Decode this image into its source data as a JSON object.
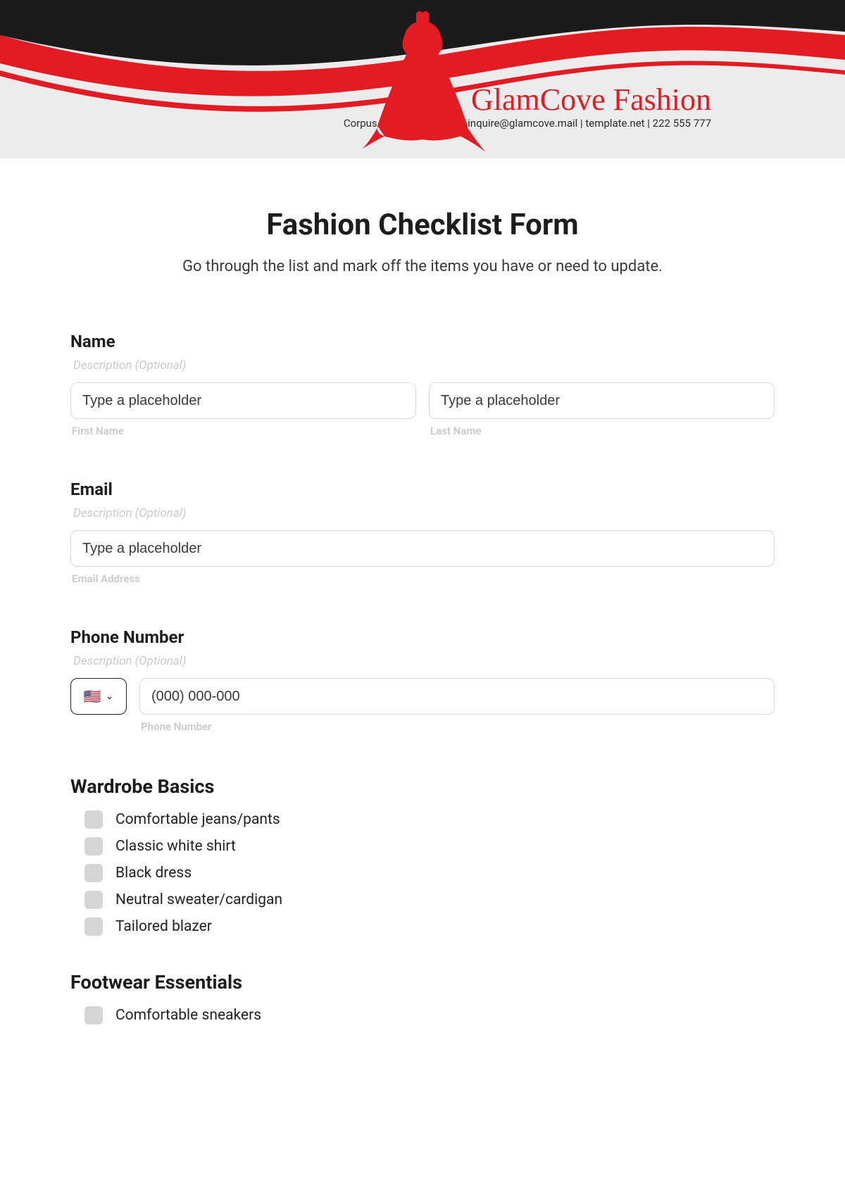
{
  "header": {
    "brand_name": "GlamCove Fashion",
    "contact_line": "Corpus Christi, TX 78401 | inquire@glamcove.mail | template.net | 222 555 777"
  },
  "form": {
    "title": "Fashion Checklist Form",
    "subtitle": "Go through the list and mark off the items you have or need to update.",
    "name": {
      "label": "Name",
      "description": "Description (Optional)",
      "first_placeholder": "Type a placeholder",
      "first_sublabel": "First Name",
      "last_placeholder": "Type a placeholder",
      "last_sublabel": "Last Name"
    },
    "email": {
      "label": "Email",
      "description": "Description (Optional)",
      "placeholder": "Type a placeholder",
      "sublabel": "Email Address"
    },
    "phone": {
      "label": "Phone Number",
      "description": "Description (Optional)",
      "flag": "🇺🇸",
      "placeholder": "(000) 000-000",
      "sublabel": "Phone Number"
    },
    "sections": {
      "wardrobe": {
        "heading": "Wardrobe Basics",
        "items": [
          "Comfortable jeans/pants",
          "Classic white shirt",
          "Black dress",
          "Neutral sweater/cardigan",
          "Tailored blazer"
        ]
      },
      "footwear": {
        "heading": "Footwear Essentials",
        "items": [
          "Comfortable sneakers"
        ]
      }
    }
  }
}
